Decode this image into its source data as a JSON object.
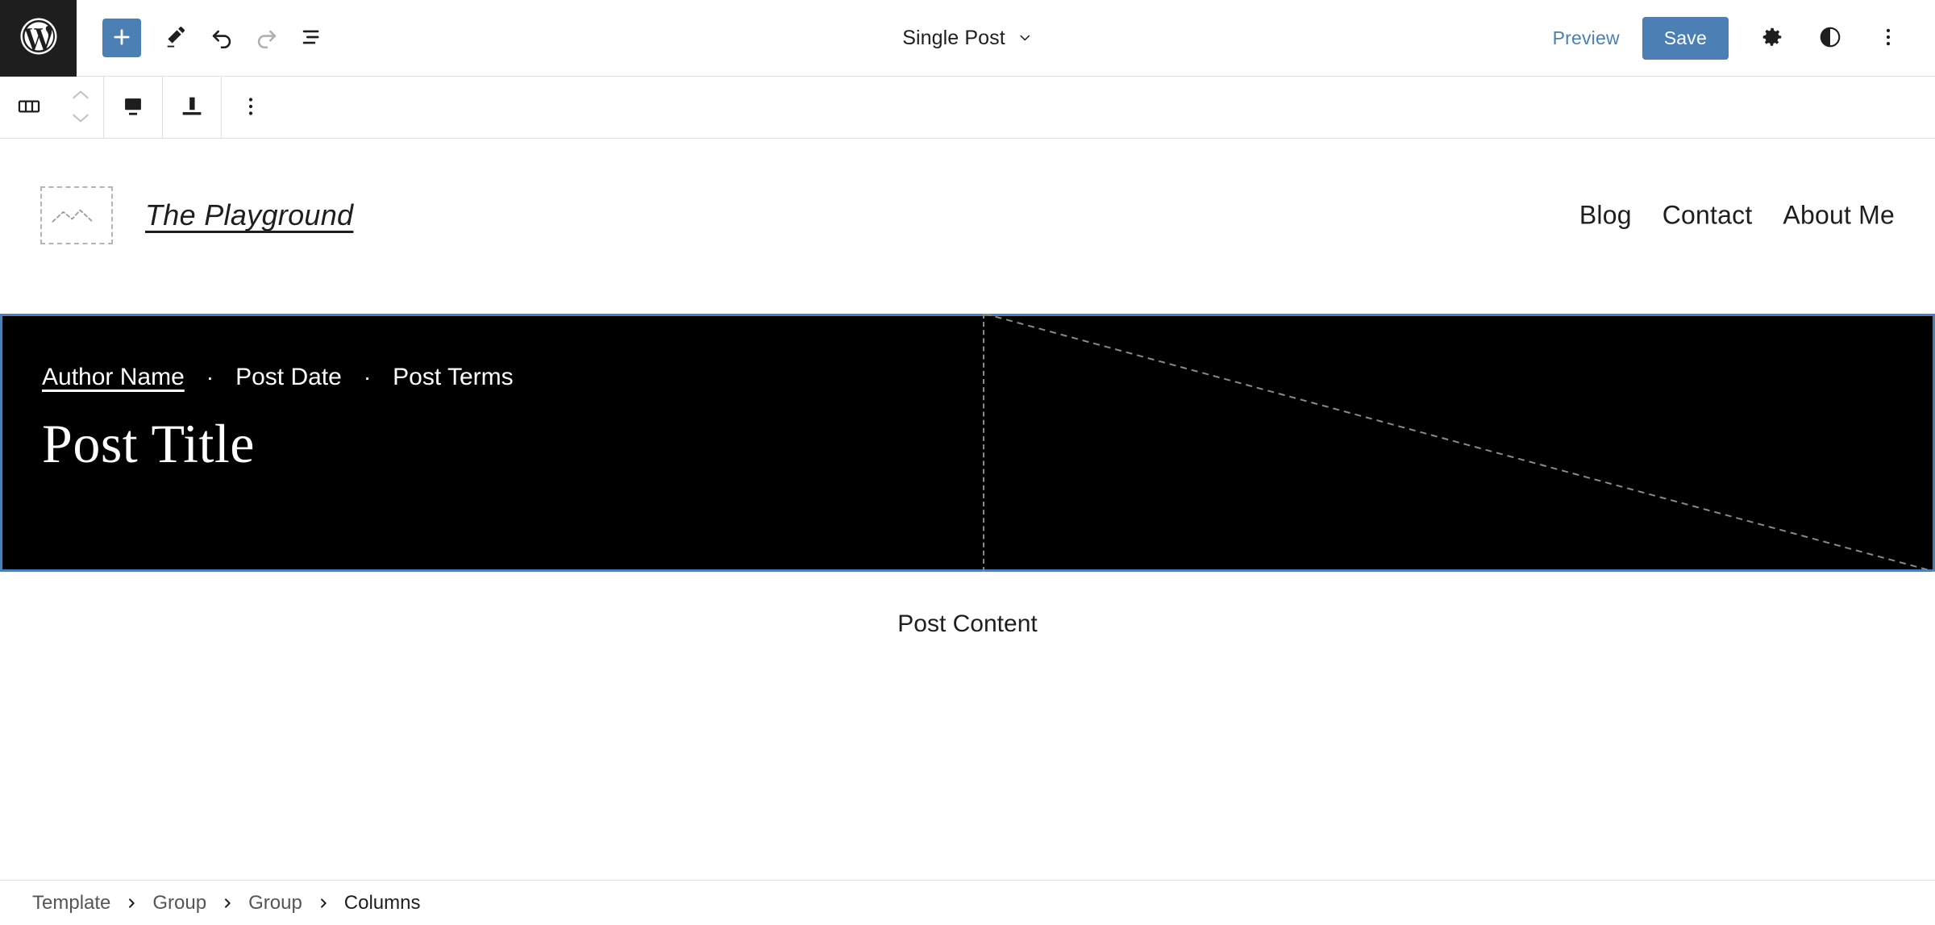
{
  "topbar": {
    "logo_icon": "wordpress-logo-icon",
    "add_block_label": "+",
    "tools": [
      {
        "name": "add-block-button",
        "icon": "plus-icon"
      },
      {
        "name": "edit-tool-button",
        "icon": "pencil-icon"
      },
      {
        "name": "undo-button",
        "icon": "undo-arrow-icon"
      },
      {
        "name": "redo-button",
        "icon": "redo-arrow-icon"
      },
      {
        "name": "list-view-button",
        "icon": "list-view-icon"
      }
    ],
    "document_title": "Single Post",
    "document_chevron": "chevron-down-icon",
    "preview_label": "Preview",
    "save_label": "Save",
    "settings_icon": "gear-icon",
    "styles_icon": "contrast-circle-icon",
    "options_icon": "more-vertical-icon",
    "accent_color": "#4c80b4",
    "logo_bg": "#1e1e1e"
  },
  "block_toolbar": {
    "block_type_icon": "columns-icon",
    "move_up_icon": "chevron-up-icon",
    "move_down_icon": "chevron-down-icon",
    "align_icon": "align-bottom-icon",
    "vertical_align_icon": "vertical-align-bottom-icon",
    "options_icon": "more-vertical-icon"
  },
  "canvas": {
    "site_header": {
      "logo_placeholder_icon": "image-placeholder-icon",
      "site_title": "The Playground",
      "nav_items": [
        "Blog",
        "Contact",
        "About Me"
      ]
    },
    "post_block": {
      "background_color": "#000000",
      "selection_color": "#4c80b4",
      "author": "Author Name",
      "separator": "·",
      "date": "Post Date",
      "terms": "Post Terms",
      "title": "Post Title",
      "empty_column_placeholder": "diagonal-dashed-placeholder"
    },
    "post_content_label": "Post Content"
  },
  "breadcrumb": {
    "separator_icon": "chevron-right-icon",
    "items": [
      "Template",
      "Group",
      "Group",
      "Columns"
    ]
  }
}
